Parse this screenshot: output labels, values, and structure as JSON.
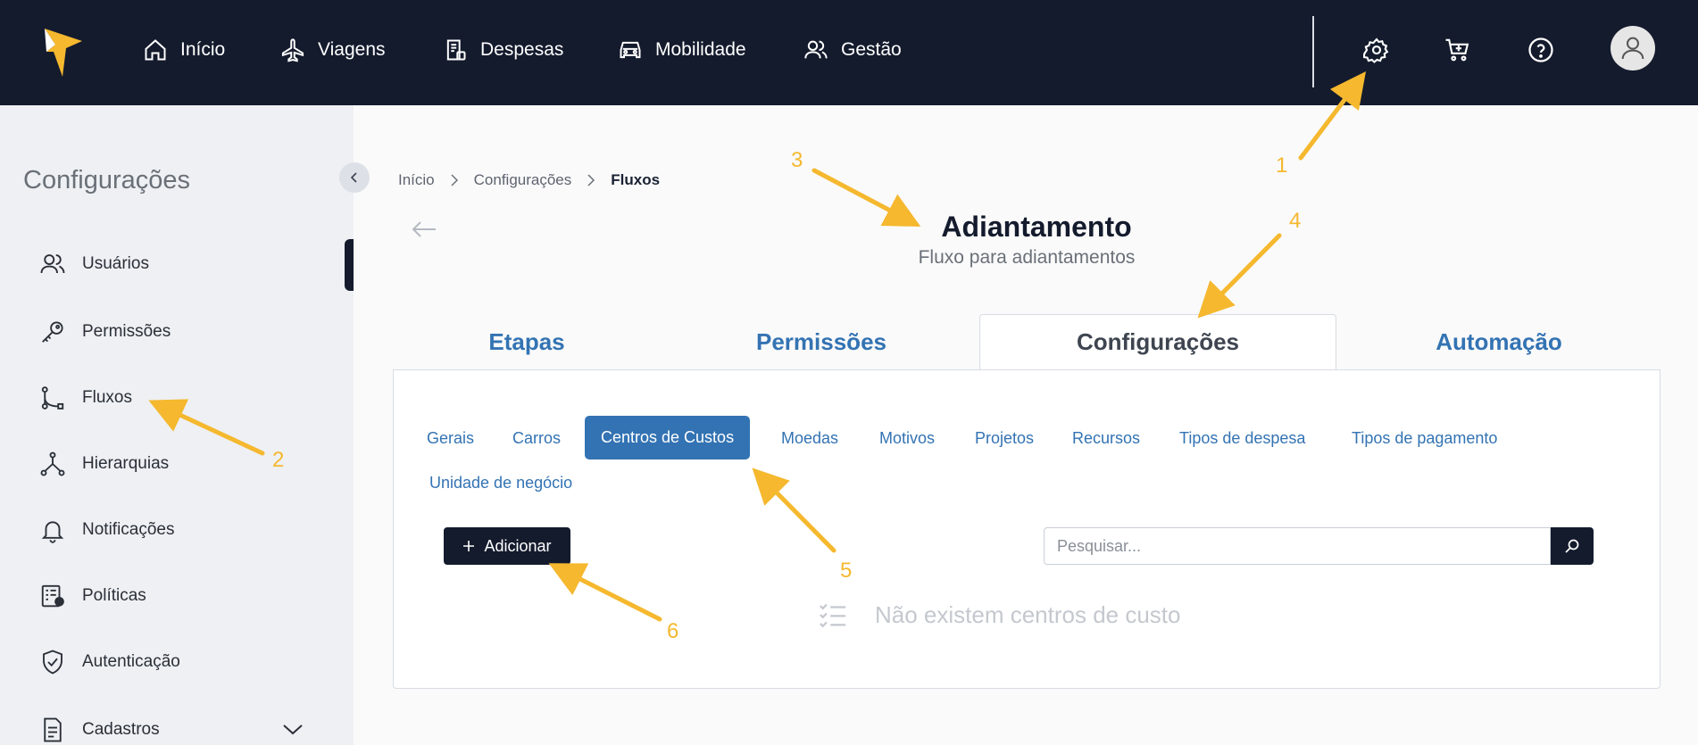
{
  "topnav": {
    "items": [
      {
        "label": "Início",
        "icon": "home-icon"
      },
      {
        "label": "Viagens",
        "icon": "plane-icon"
      },
      {
        "label": "Despesas",
        "icon": "receipt-icon"
      },
      {
        "label": "Mobilidade",
        "icon": "car-icon"
      },
      {
        "label": "Gestão",
        "icon": "users-icon"
      }
    ],
    "right_icons": [
      "gear-icon",
      "cart-icon",
      "help-icon",
      "user-avatar-icon"
    ]
  },
  "sidebar": {
    "title": "Configurações",
    "items": [
      {
        "label": "Usuários",
        "icon": "users-icon"
      },
      {
        "label": "Permissões",
        "icon": "key-icon"
      },
      {
        "label": "Fluxos",
        "icon": "flow-icon"
      },
      {
        "label": "Hierarquias",
        "icon": "hierarchy-icon"
      },
      {
        "label": "Notificações",
        "icon": "bell-icon"
      },
      {
        "label": "Políticas",
        "icon": "policy-icon"
      },
      {
        "label": "Autenticação",
        "icon": "shield-icon"
      },
      {
        "label": "Cadastros",
        "icon": "document-icon"
      }
    ]
  },
  "breadcrumb": [
    "Início",
    "Configurações",
    "Fluxos"
  ],
  "page": {
    "title": "Adiantamento",
    "subtitle": "Fluxo para adiantamentos"
  },
  "tabs": [
    {
      "label": "Etapas",
      "active": false
    },
    {
      "label": "Permissões",
      "active": false
    },
    {
      "label": "Configurações",
      "active": true
    },
    {
      "label": "Automação",
      "active": false
    }
  ],
  "subtabs": [
    {
      "label": "Gerais",
      "active": false
    },
    {
      "label": "Carros",
      "active": false
    },
    {
      "label": "Centros de Custos",
      "active": true
    },
    {
      "label": "Moedas",
      "active": false
    },
    {
      "label": "Motivos",
      "active": false
    },
    {
      "label": "Projetos",
      "active": false
    },
    {
      "label": "Recursos",
      "active": false
    },
    {
      "label": "Tipos de despesa",
      "active": false
    },
    {
      "label": "Tipos de pagamento",
      "active": false
    },
    {
      "label": "Unidade de negócio",
      "active": false
    }
  ],
  "actions": {
    "add_label": "Adicionar",
    "search_placeholder": "Pesquisar..."
  },
  "empty_state": "Não existem centros de custo",
  "annotations": [
    "1",
    "2",
    "3",
    "4",
    "5",
    "6"
  ],
  "colors": {
    "nav_bg": "#141b2d",
    "accent": "#3373b3",
    "annotation": "#f5b82e",
    "logo": "#f5b82e"
  }
}
